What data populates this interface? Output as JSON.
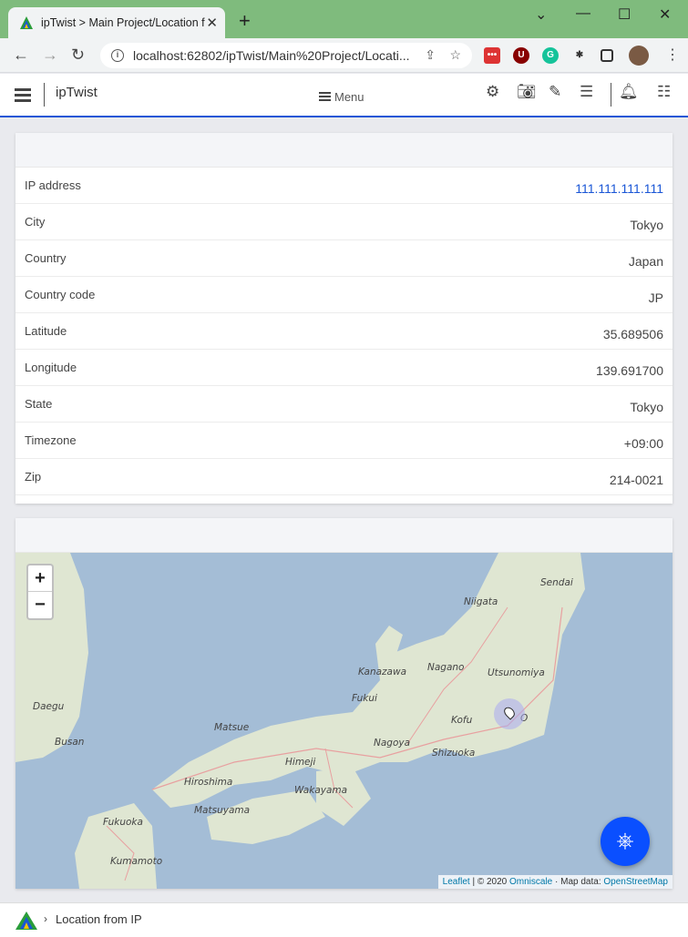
{
  "browser": {
    "tab_title": "ipTwist > Main Project/Location f",
    "url": "localhost:62802/ipTwist/Main%20Project/Locati..."
  },
  "app": {
    "title": "ipTwist",
    "menu_label": "Menu"
  },
  "info": {
    "rows": [
      {
        "label": "IP address",
        "value": "111.111.111.111"
      },
      {
        "label": "City",
        "value": "Tokyo"
      },
      {
        "label": "Country",
        "value": "Japan"
      },
      {
        "label": "Country code",
        "value": "JP"
      },
      {
        "label": "Latitude",
        "value": "35.689506"
      },
      {
        "label": "Longitude",
        "value": "139.691700"
      },
      {
        "label": "State",
        "value": "Tokyo"
      },
      {
        "label": "Timezone",
        "value": "+09:00"
      },
      {
        "label": "Zip",
        "value": "214-0021"
      }
    ]
  },
  "map": {
    "zoom_in": "+",
    "zoom_out": "−",
    "attribution": {
      "leaflet": "Leaflet",
      "sep1": " | © 2020 ",
      "omniscale": "Omniscale",
      "sep2": " · Map data: ",
      "osm": "OpenStreetMap"
    },
    "places": {
      "sendai": "Sendai",
      "niigata": "Niigata",
      "kanazawa": "Kanazawa",
      "nagano": "Nagano",
      "utsunomiya": "Utsunomiya",
      "fukui": "Fukui",
      "daegu": "Daegu",
      "matsue": "Matsue",
      "kofu": "Kofu",
      "tokyo_partial": "O",
      "busan": "Busan",
      "nagoya": "Nagoya",
      "himeji": "Himeji",
      "shizuoka": "Shizuoka",
      "hiroshima": "Hiroshima",
      "wakayama": "Wakayama",
      "matsuyama": "Matsuyama",
      "fukuoka": "Fukuoka",
      "kumamoto": "Kumamoto"
    }
  },
  "footer": {
    "breadcrumb": "Location from IP"
  },
  "colors": {
    "accent": "#1a56d6",
    "fab": "#0a4fff",
    "titlebar": "#7fbb7d"
  }
}
